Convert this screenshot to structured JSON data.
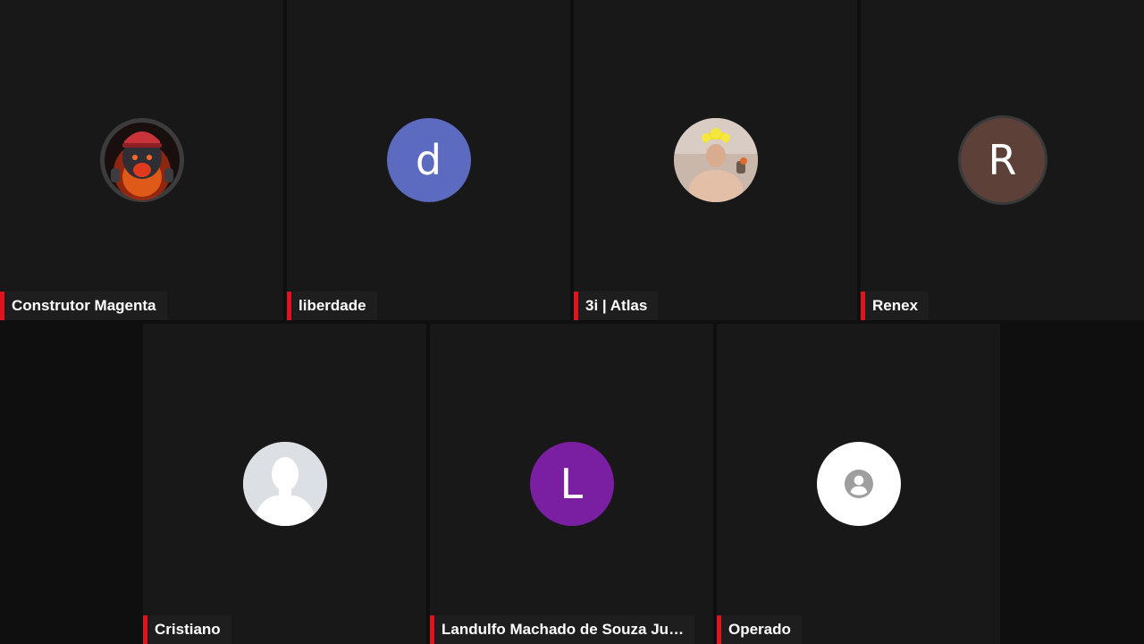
{
  "colors": {
    "background": "#0f0f0f",
    "tile_background": "#181818",
    "nametag_background": "#1e1e1e",
    "speaker_bar": "#e0141e"
  },
  "participants": [
    {
      "name": "Construtor Magenta",
      "avatar_type": "image",
      "avatar_description": "bear-in-helmet-icon"
    },
    {
      "name": "liberdade",
      "avatar_type": "initial",
      "initial": "d",
      "color": "#5c6bc0"
    },
    {
      "name": "3i | Atlas",
      "avatar_type": "image",
      "avatar_description": "person-photo-icon"
    },
    {
      "name": "Renex",
      "avatar_type": "initial",
      "initial": "R",
      "color": "#5d4037"
    },
    {
      "name": "Cristiano",
      "avatar_type": "silhouette"
    },
    {
      "name": "Landulfo Machado de Souza Ju…",
      "avatar_type": "initial",
      "initial": "L",
      "color": "#7b1fa2"
    },
    {
      "name": "Operado",
      "avatar_type": "generic-account",
      "color": "#ffffff"
    }
  ]
}
